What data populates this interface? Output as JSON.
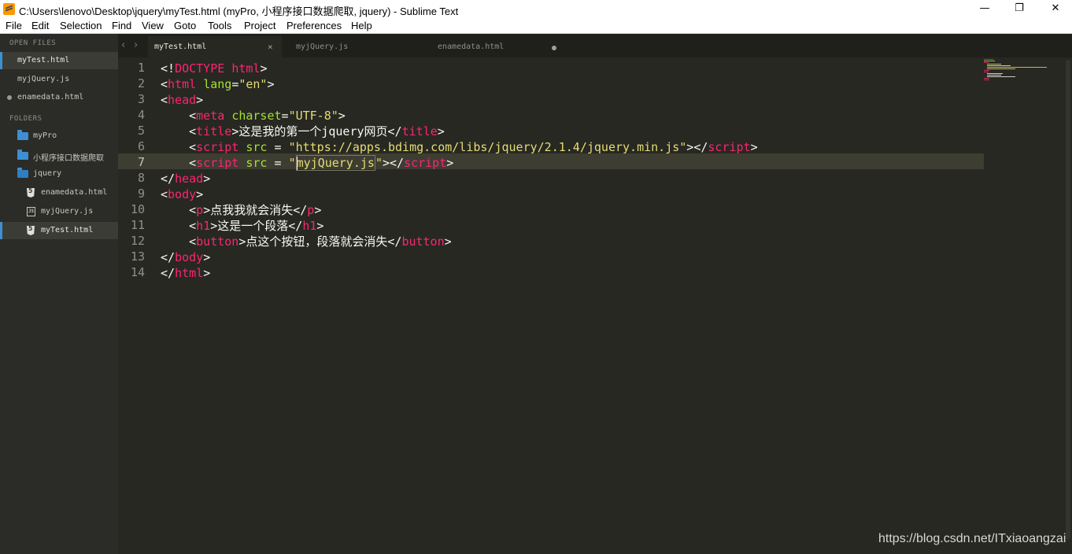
{
  "window": {
    "title": "C:\\Users\\lenovo\\Desktop\\jquery\\myTest.html (myPro, 小程序接口数据爬取, jquery) - Sublime Text",
    "minimize": "—",
    "maximize": "❐",
    "close": "✕"
  },
  "menu": [
    "File",
    "Edit",
    "Selection",
    "Find",
    "View",
    "Goto",
    "Tools",
    "Project",
    "Preferences",
    "Help"
  ],
  "sidebar": {
    "open_files_header": "OPEN FILES",
    "open_files": [
      "myTest.html",
      "myjQuery.js",
      "enamedata.html"
    ],
    "folders_header": "FOLDERS",
    "folders": [
      "myPro",
      "小程序接口数据爬取",
      "jquery"
    ],
    "files": [
      "enamedata.html",
      "myjQuery.js",
      "myTest.html"
    ]
  },
  "tabs": {
    "back": "‹",
    "forward": "›",
    "items": [
      "myTest.html",
      "myjQuery.js",
      "enamedata.html"
    ],
    "close": "×"
  },
  "gutter": [
    "1",
    "2",
    "3",
    "4",
    "5",
    "6",
    "7",
    "8",
    "9",
    "10",
    "11",
    "12",
    "13",
    "14"
  ],
  "code": [
    [
      {
        "c": "p",
        "v": "<!"
      },
      {
        "c": "t",
        "v": "DOCTYPE"
      },
      {
        "c": "p",
        "v": " "
      },
      {
        "c": "t",
        "v": "html"
      },
      {
        "c": "p",
        "v": ">"
      }
    ],
    [
      {
        "c": "p",
        "v": "<"
      },
      {
        "c": "t",
        "v": "html"
      },
      {
        "c": "p",
        "v": " "
      },
      {
        "c": "a",
        "v": "lang"
      },
      {
        "c": "p",
        "v": "="
      },
      {
        "c": "s",
        "v": "\"en\""
      },
      {
        "c": "p",
        "v": ">"
      }
    ],
    [
      {
        "c": "p",
        "v": "<"
      },
      {
        "c": "t",
        "v": "head"
      },
      {
        "c": "p",
        "v": ">"
      }
    ],
    [
      {
        "c": "p",
        "v": "    <"
      },
      {
        "c": "t",
        "v": "meta"
      },
      {
        "c": "p",
        "v": " "
      },
      {
        "c": "a",
        "v": "charset"
      },
      {
        "c": "p",
        "v": "="
      },
      {
        "c": "s",
        "v": "\"UTF-8\""
      },
      {
        "c": "p",
        "v": ">"
      }
    ],
    [
      {
        "c": "p",
        "v": "    <"
      },
      {
        "c": "t",
        "v": "title"
      },
      {
        "c": "p",
        "v": ">这是我的第一个jquery网页</"
      },
      {
        "c": "t",
        "v": "title"
      },
      {
        "c": "p",
        "v": ">"
      }
    ],
    [
      {
        "c": "p",
        "v": "    <"
      },
      {
        "c": "t",
        "v": "script"
      },
      {
        "c": "p",
        "v": " "
      },
      {
        "c": "a",
        "v": "src"
      },
      {
        "c": "p",
        "v": " = "
      },
      {
        "c": "s",
        "v": "\"https://apps.bdimg.com/libs/jquery/2.1.4/jquery.min.js\""
      },
      {
        "c": "p",
        "v": "></"
      },
      {
        "c": "t",
        "v": "script"
      },
      {
        "c": "p",
        "v": ">"
      }
    ],
    [
      {
        "c": "p",
        "v": "    <"
      },
      {
        "c": "t",
        "v": "script"
      },
      {
        "c": "p",
        "v": " "
      },
      {
        "c": "a",
        "v": "src"
      },
      {
        "c": "p",
        "v": " = "
      },
      {
        "c": "s",
        "v": "\""
      },
      {
        "c": "caret",
        "v": ""
      },
      {
        "c": "sh",
        "v": "myjQuery.js"
      },
      {
        "c": "s",
        "v": "\""
      },
      {
        "c": "p",
        "v": "></"
      },
      {
        "c": "t",
        "v": "script"
      },
      {
        "c": "p",
        "v": ">"
      }
    ],
    [
      {
        "c": "p",
        "v": "</"
      },
      {
        "c": "t",
        "v": "head"
      },
      {
        "c": "p",
        "v": ">"
      }
    ],
    [
      {
        "c": "p",
        "v": "<"
      },
      {
        "c": "t",
        "v": "body"
      },
      {
        "c": "p",
        "v": ">"
      }
    ],
    [
      {
        "c": "p",
        "v": "    <"
      },
      {
        "c": "t",
        "v": "p"
      },
      {
        "c": "p",
        "v": ">点我我就会消失</"
      },
      {
        "c": "t",
        "v": "p"
      },
      {
        "c": "p",
        "v": ">"
      }
    ],
    [
      {
        "c": "p",
        "v": "    <"
      },
      {
        "c": "t",
        "v": "h1"
      },
      {
        "c": "p",
        "v": ">这是一个段落</"
      },
      {
        "c": "t",
        "v": "h1"
      },
      {
        "c": "p",
        "v": ">"
      }
    ],
    [
      {
        "c": "p",
        "v": "    <"
      },
      {
        "c": "t",
        "v": "button"
      },
      {
        "c": "p",
        "v": ">点这个按钮，段落就会消失</"
      },
      {
        "c": "t",
        "v": "button"
      },
      {
        "c": "p",
        "v": ">"
      }
    ],
    [
      {
        "c": "p",
        "v": "</"
      },
      {
        "c": "t",
        "v": "body"
      },
      {
        "c": "p",
        "v": ">"
      }
    ],
    [
      {
        "c": "p",
        "v": "</"
      },
      {
        "c": "t",
        "v": "html"
      },
      {
        "c": "p",
        "v": ">"
      }
    ]
  ],
  "current_line": 7,
  "watermark": "https://blog.csdn.net/ITxiaoangzai",
  "colors": {
    "background": "#272822",
    "tag": "#f92672",
    "attribute": "#a6e22e",
    "string": "#e6db74",
    "text": "#f8f8f2",
    "accent": "#3d8fd1"
  }
}
